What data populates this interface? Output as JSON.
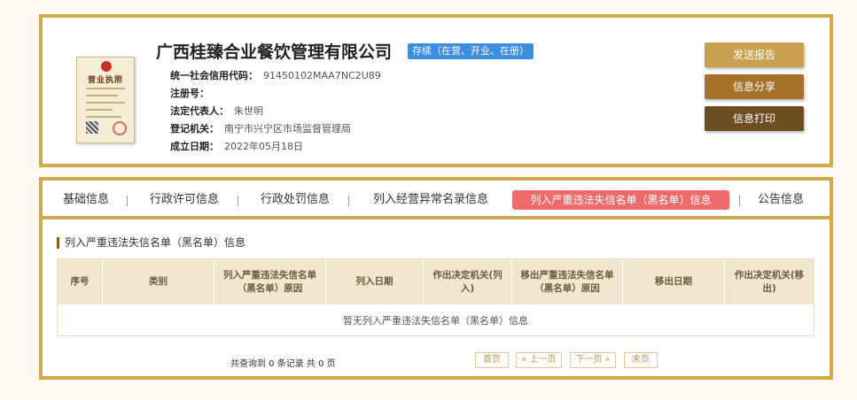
{
  "company": {
    "license_image_label": "营业执照",
    "name": "广西桂臻合业餐饮管理有限公司",
    "status": "存续（在营、开业、在册）",
    "fields": [
      {
        "label": "统一社会信用代码：",
        "value": "91450102MAA7NC2U89"
      },
      {
        "label": "注册号：",
        "value": ""
      },
      {
        "label": "法定代表人：",
        "value": "朱世明"
      },
      {
        "label": "登记机关：",
        "value": "南宁市兴宁区市场监督管理局"
      },
      {
        "label": "成立日期：",
        "value": "2022年05月18日"
      }
    ]
  },
  "actions": {
    "report": "发送报告",
    "share": "信息分享",
    "print": "信息打印"
  },
  "colors": {
    "border_gold": "#d2a84a",
    "status_blue": "#3b8ee0",
    "active_tab": "#ef6a6a",
    "btn_report": "#c99f50",
    "btn_share": "#a6712a",
    "btn_print": "#6b4e22"
  },
  "tabs": [
    {
      "label": "基础信息",
      "active": false
    },
    {
      "label": "行政许可信息",
      "active": false
    },
    {
      "label": "行政处罚信息",
      "active": false
    },
    {
      "label": "列入经营异常名录信息",
      "active": false
    },
    {
      "label": "列入严重违法失信名单（黑名单）信息",
      "active": true
    },
    {
      "label": "公告信息",
      "active": false
    }
  ],
  "section": {
    "title": "列入严重违法失信名单（黑名单）信息",
    "columns": [
      "序号",
      "类别",
      "列入严重违法失信名单（黑名单）原因",
      "列入日期",
      "作出决定机关(列入)",
      "移出严重违法失信名单（黑名单）原因",
      "移出日期",
      "作出决定机关(移出)"
    ],
    "empty_text": "暂无列入严重违法失信名单（黑名单）信息"
  },
  "pagination": {
    "summary": "共查询到 0 条记录 共 0 页",
    "first": "首页",
    "prev": "« 上一页",
    "next": "下一页 »",
    "last": "末页"
  }
}
